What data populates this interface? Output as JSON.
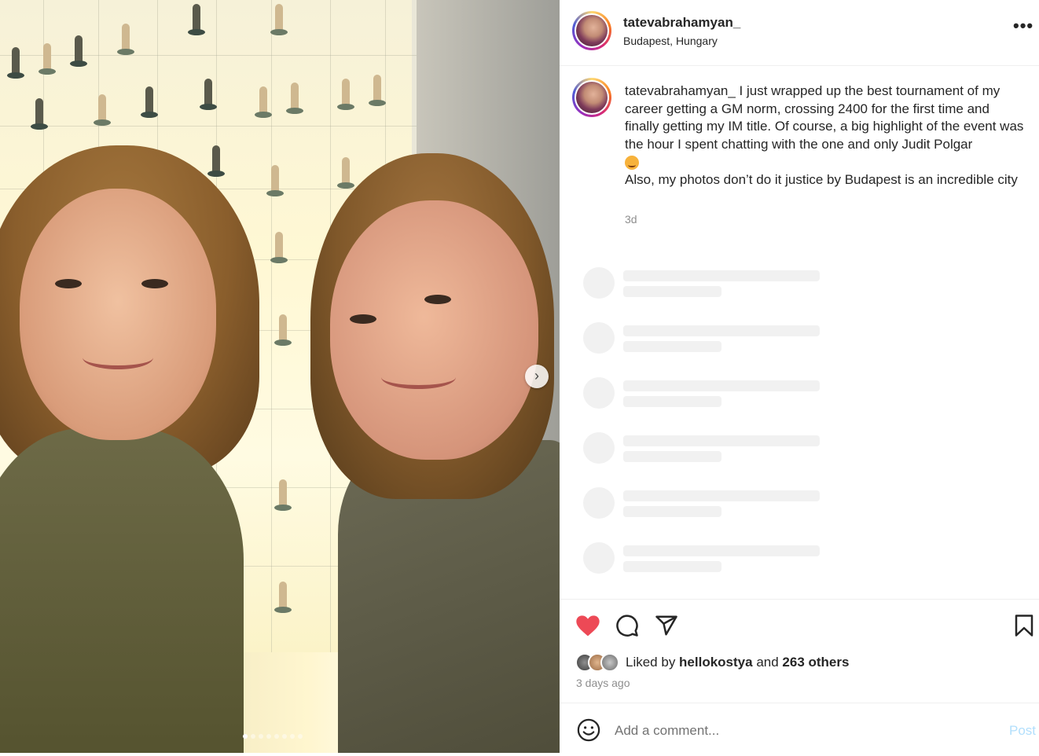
{
  "post": {
    "username": "tatevabrahamyan_",
    "location": "Budapest, Hungary",
    "more_label": "•••",
    "caption_username": "tatevabrahamyan_",
    "caption_line1": " I just wrapped up the best tournament of my career getting a GM norm, crossing 2400 for the first time and finally getting my IM title. Of course, a big highlight of the event was the hour I spent chatting with the one and only Judit Polgar",
    "caption_line2": "Also, my photos don’t do it justice by Budapest is an incredible city",
    "caption_time": "3d"
  },
  "carousel": {
    "next_label": "›",
    "slide_count": 8,
    "active_index": 0
  },
  "actions": {
    "liked": true,
    "liked_prefix": "Liked by ",
    "liked_user": "hellokostya",
    "liked_and": " and ",
    "liked_others": "263 others",
    "posted_ago": "3 days ago"
  },
  "comment": {
    "placeholder": "Add a comment...",
    "post_label": "Post"
  },
  "colors": {
    "like_red": "#ed4956",
    "post_disabled": "#b2dffc"
  },
  "icons": [
    "heart-icon",
    "comment-icon",
    "share-icon",
    "bookmark-icon",
    "emoji-icon",
    "more-icon",
    "chevron-right-icon"
  ]
}
